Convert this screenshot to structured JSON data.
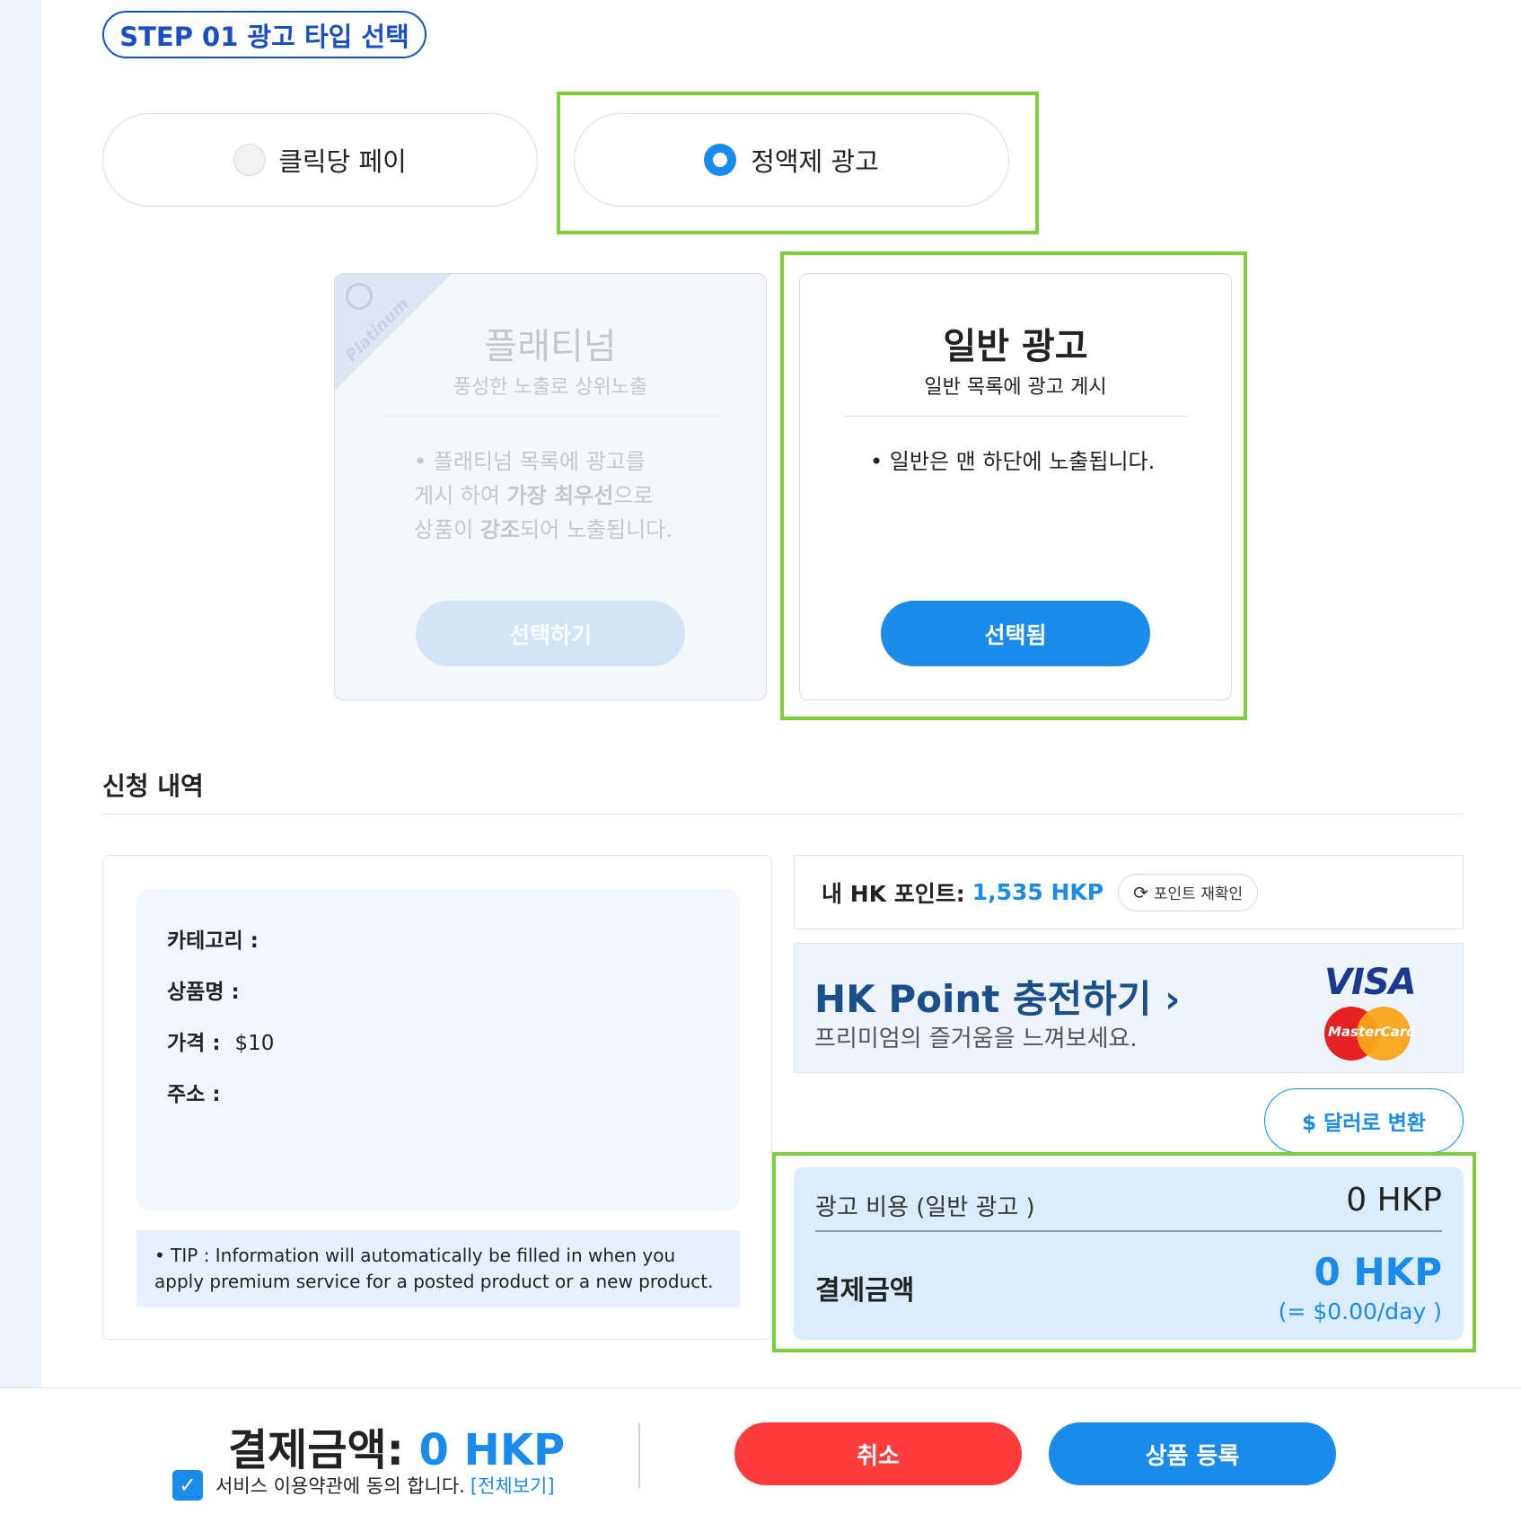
{
  "step": {
    "label": "STEP 01 광고 타입 선택"
  },
  "ad_types": [
    {
      "label": "클릭당 페이",
      "selected": false
    },
    {
      "label": "정액제 광고",
      "selected": true
    }
  ],
  "cards": {
    "platinum": {
      "ribbon": "Platinum",
      "title": "플래티넘",
      "subtitle": "풍성한 노출로 상위노출",
      "desc_1": "• 플래티넘 목록에 광고를",
      "desc_2a": "게시 하여 ",
      "desc_2b": "가장 최우선",
      "desc_2c": "으로",
      "desc_3a": "상품이 ",
      "desc_3b": "강조",
      "desc_3c": "되어 노출됩니다.",
      "button": "선택하기",
      "enabled": false
    },
    "normal": {
      "title": "일반 광고",
      "subtitle": "일반 목록에 광고 게시",
      "desc": "• 일반은 맨 하단에 노출됩니다.",
      "button": "선택됨",
      "selected": true
    }
  },
  "summary": {
    "title": "신청 내역",
    "category_label": "카테고리 :",
    "product_label": "상품명 :",
    "price_label": "가격 :",
    "price_value": "$10",
    "address_label": "주소 :",
    "tip": "• TIP : Information will automatically be filled in when you apply premium service for a posted product or a new product."
  },
  "points": {
    "label": "내 HK 포인트:",
    "value": "1,535 HKP",
    "recheck": "포인트 재확인"
  },
  "charge": {
    "title": "HK Point 충전하기 ›",
    "subtitle": "프리미엄의 즐거움을 느껴보세요.",
    "visa": "VISA",
    "mastercard": "MasterCard"
  },
  "convert_button": "$ 달러로 변환",
  "cost": {
    "ad_cost_label": "광고 비용 (일반 광고 )",
    "ad_cost_value": "0 HKP",
    "pay_label": "결제금액",
    "pay_value": "0 HKP",
    "pay_per_day": "(= $0.00/day )"
  },
  "footer": {
    "total_label": "결제금액: ",
    "total_value": "0 HKP",
    "agree_text": "서비스 이용약관에 동의 합니다.",
    "agree_link": "[전체보기]",
    "agree_checked": true,
    "cancel": "취소",
    "register": "상품 등록"
  },
  "colors": {
    "accent": "#1b8bea",
    "highlight": "#7ed03a",
    "cancel": "#ff3b3b"
  }
}
